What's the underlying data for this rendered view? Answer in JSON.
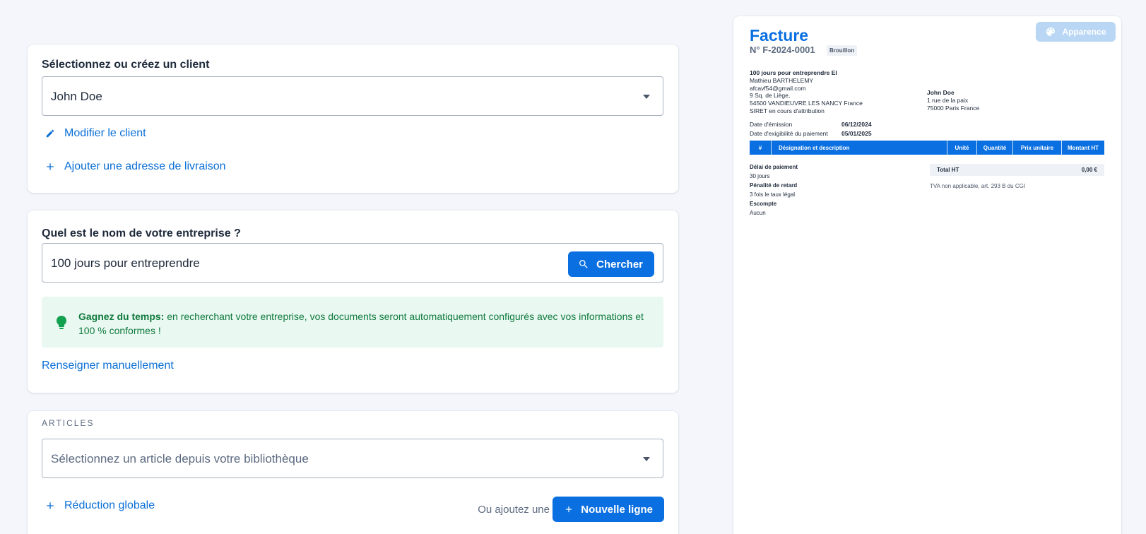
{
  "client_card": {
    "title": "Sélectionnez ou créez un client",
    "selected_client": "John Doe",
    "edit_client_label": "Modifier le client",
    "add_delivery_address_label": "Ajouter une adresse de livraison"
  },
  "company_card": {
    "title": "Quel est le nom de votre entreprise ?",
    "company_value": "100 jours pour entreprendre",
    "search_button_label": "Chercher",
    "tip_bold": "Gagnez du temps:",
    "tip_text": " en recherchant votre entreprise, vos documents seront automatiquement configurés avec vos informations et 100 % conformes !",
    "manual_link_label": "Renseigner manuellement"
  },
  "articles_card": {
    "section_label": "ARTICLES",
    "select_placeholder": "Sélectionnez un article depuis votre bibliothèque",
    "global_discount_label": "Réduction globale",
    "or_add_text": "Ou ajoutez une",
    "new_line_button_label": "Nouvelle ligne"
  },
  "preview": {
    "appearance_button_label": "Apparence",
    "title": "Facture",
    "number": "N° F-2024-0001",
    "status_badge": "Brouillon",
    "sender": {
      "name": "100 jours pour entreprendre EI",
      "person": "Mathieu BARTHELEMY",
      "email": "afcavf54@gmail.com",
      "address1": "9 Sq. de Liège,",
      "address2": "54500 VANDIEUVRE LES NANCY France",
      "siret": "SIRET en cours d'attribution"
    },
    "client": {
      "name": "John Doe",
      "address1": "1 rue de la paix",
      "address2": "75000 Paris France"
    },
    "dates": {
      "issue_label": "Date d'émission",
      "issue_value": "06/12/2024",
      "due_label": "Date d'exigibilité du paiement",
      "due_value": "05/01/2025"
    },
    "table_headers": [
      "#",
      "Désignation et description",
      "Unité",
      "Quantité",
      "Prix unitaire",
      "Montant HT"
    ],
    "terms": {
      "payment_delay_label": "Délai de paiement",
      "payment_delay_value": "30 jours",
      "late_penalty_label": "Pénalité de retard",
      "late_penalty_value": "3 fois le taux légal",
      "discount_label": "Escompte",
      "discount_value": "Aucun"
    },
    "total_label": "Total HT",
    "total_value": "0,00 €",
    "tva_note": "TVA non applicable, art. 293 B du CGI"
  },
  "colors": {
    "accent": "#0a6fe0",
    "link": "#0a6fd6",
    "tip_background": "#e9f8f1",
    "tip_text": "#107a3e",
    "page_background": "#f4f6fb"
  },
  "icons": {
    "edit": "pencil-icon",
    "add": "plus-icon",
    "search": "search-icon",
    "tip": "lightbulb-icon",
    "appearance": "palette-icon",
    "dropdown": "chevron-down-icon"
  }
}
